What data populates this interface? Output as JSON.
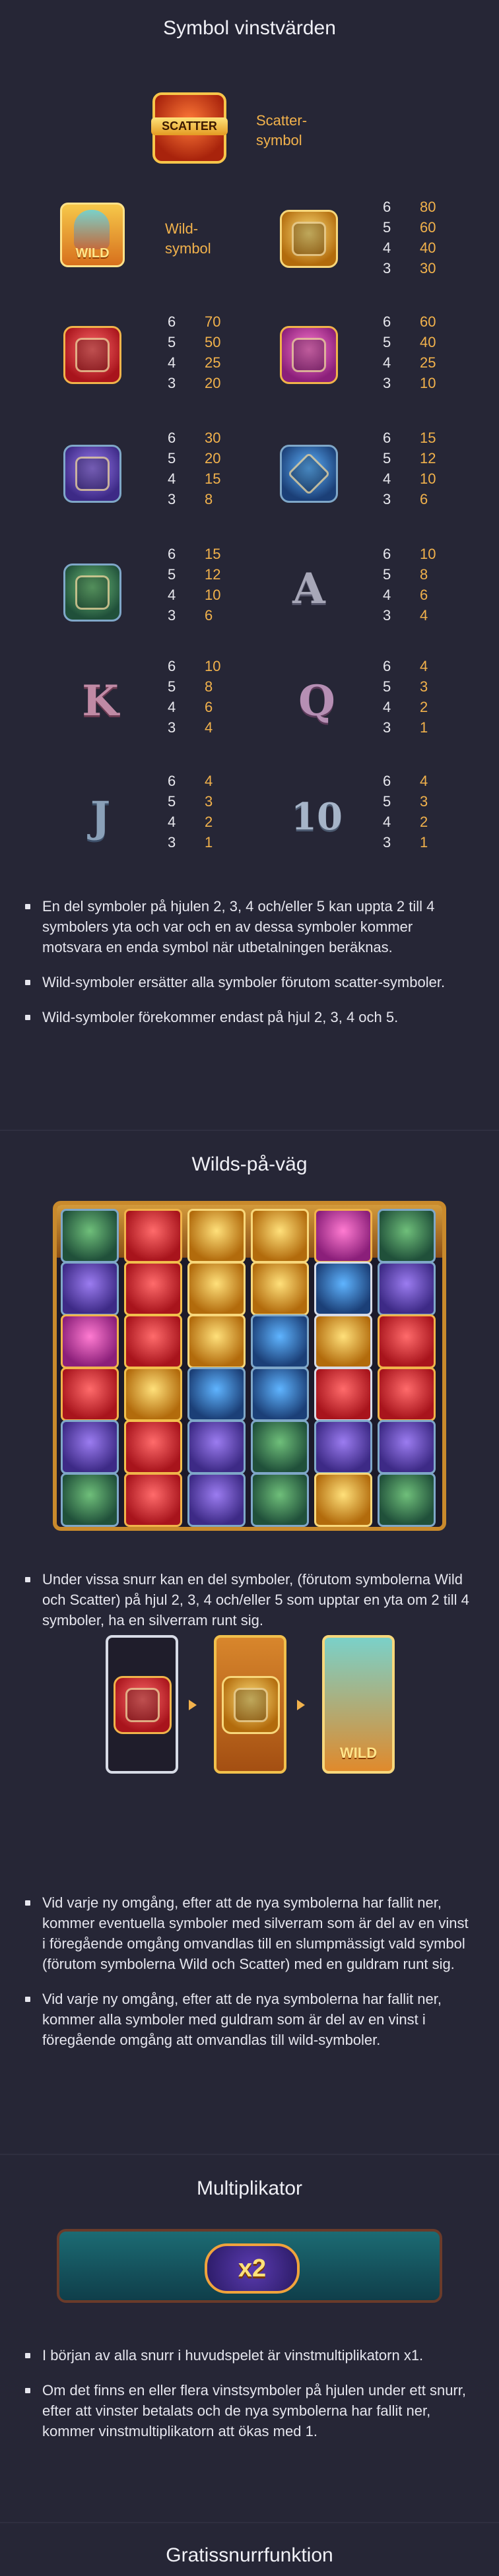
{
  "sections": {
    "symbol_values": {
      "title": "Symbol vinstvärden"
    },
    "wilds_on_the_way": {
      "title": "Wilds-på-väg"
    },
    "multiplier": {
      "title": "Multiplikator"
    },
    "free_spins": {
      "title": "Gratissnurrfunktion"
    }
  },
  "symbols": {
    "scatter": {
      "tile_label": "SCATTER",
      "caption": "Scatter-\nsymbol"
    },
    "wild": {
      "tile_label": "WILD",
      "caption": "Wild-\nsymbol"
    },
    "letters": {
      "a": "A",
      "k": "K",
      "q": "Q",
      "j": "J",
      "ten": "10"
    }
  },
  "paytable": {
    "gold_mask": [
      [
        "6",
        "80"
      ],
      [
        "5",
        "60"
      ],
      [
        "4",
        "40"
      ],
      [
        "3",
        "30"
      ]
    ],
    "red_mask": [
      [
        "6",
        "70"
      ],
      [
        "5",
        "50"
      ],
      [
        "4",
        "25"
      ],
      [
        "3",
        "20"
      ]
    ],
    "pink_bird": [
      [
        "6",
        "60"
      ],
      [
        "5",
        "40"
      ],
      [
        "4",
        "25"
      ],
      [
        "3",
        "10"
      ]
    ],
    "purple_bird": [
      [
        "6",
        "30"
      ],
      [
        "5",
        "20"
      ],
      [
        "4",
        "15"
      ],
      [
        "3",
        "8"
      ]
    ],
    "blue_cross": [
      [
        "6",
        "15"
      ],
      [
        "5",
        "12"
      ],
      [
        "4",
        "10"
      ],
      [
        "3",
        "6"
      ]
    ],
    "green_glyph": [
      [
        "6",
        "15"
      ],
      [
        "5",
        "12"
      ],
      [
        "4",
        "10"
      ],
      [
        "3",
        "6"
      ]
    ],
    "a": [
      [
        "6",
        "10"
      ],
      [
        "5",
        "8"
      ],
      [
        "4",
        "6"
      ],
      [
        "3",
        "4"
      ]
    ],
    "k": [
      [
        "6",
        "10"
      ],
      [
        "5",
        "8"
      ],
      [
        "4",
        "6"
      ],
      [
        "3",
        "4"
      ]
    ],
    "q": [
      [
        "6",
        "4"
      ],
      [
        "5",
        "3"
      ],
      [
        "4",
        "2"
      ],
      [
        "3",
        "1"
      ]
    ],
    "j": [
      [
        "6",
        "4"
      ],
      [
        "5",
        "3"
      ],
      [
        "4",
        "2"
      ],
      [
        "3",
        "1"
      ]
    ],
    "ten": [
      [
        "6",
        "4"
      ],
      [
        "5",
        "3"
      ],
      [
        "4",
        "2"
      ],
      [
        "3",
        "1"
      ]
    ]
  },
  "bullets": {
    "symbol_values": [
      "En del symboler på hjulen 2, 3, 4 och/eller 5 kan uppta 2 till 4 symbolers yta och var och en av dessa symboler kommer motsvara en enda symbol när utbetalningen beräknas.",
      "Wild-symboler ersätter alla symboler förutom scatter-symboler.",
      "Wild-symboler förekommer endast på hjul 2, 3, 4 och 5."
    ],
    "wilds_intro": [
      "Under vissa snurr kan en del symboler, (förutom symbolerna Wild och Scatter) på hjul 2, 3, 4 och/eller 5 som upptar en yta om 2 till 4 symboler, ha en silverram runt sig."
    ],
    "wilds_details": [
      "Vid varje ny omgång, efter att de nya symbolerna har fallit ner, kommer eventuella symboler med silverram som är del av en vinst i föregående omgång omvandlas till en slumpmässigt vald symbol (förutom symbolerna Wild och Scatter) med en guldram runt sig.",
      "Vid varje ny omgång, efter att de nya symbolerna har fallit ner, kommer alla symboler med guldram som är del av en vinst i föregående omgång att omvandlas till wild-symboler."
    ],
    "multiplier": [
      "I början av alla snurr i huvudspelet är vinstmultiplikatorn x1.",
      "Om det finns en eller flera vinstsymboler på hjulen under ett snurr, efter att vinster betalats och de nya symbolerna har fallit ner, kommer vinstmultiplikatorn att ökas med 1."
    ]
  },
  "multiplier_badge": "x2",
  "colors": {
    "background": "#262636",
    "accent": "#f2b24c",
    "text": "#e9e9f0"
  }
}
